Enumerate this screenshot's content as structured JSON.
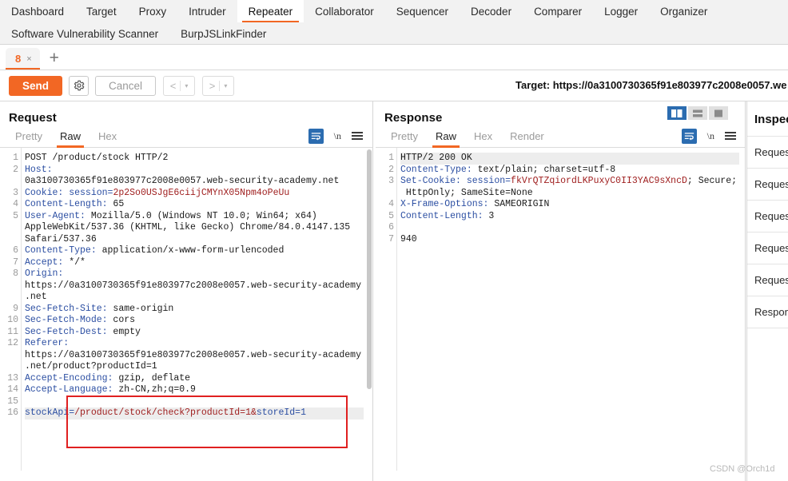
{
  "nav": {
    "row1": [
      {
        "label": "Dashboard",
        "active": false
      },
      {
        "label": "Target",
        "active": false
      },
      {
        "label": "Proxy",
        "active": false
      },
      {
        "label": "Intruder",
        "active": false
      },
      {
        "label": "Repeater",
        "active": true
      },
      {
        "label": "Collaborator",
        "active": false
      },
      {
        "label": "Sequencer",
        "active": false
      },
      {
        "label": "Decoder",
        "active": false
      },
      {
        "label": "Comparer",
        "active": false
      },
      {
        "label": "Logger",
        "active": false
      },
      {
        "label": "Organizer",
        "active": false
      }
    ],
    "row2": [
      {
        "label": "Software Vulnerability Scanner",
        "active": false
      },
      {
        "label": "BurpJSLinkFinder",
        "active": false
      }
    ]
  },
  "tabstrip": {
    "tabs": [
      {
        "label": "8",
        "close": "×"
      }
    ],
    "add_label": "+"
  },
  "toolbar": {
    "send_label": "Send",
    "settings_icon": "gear-icon",
    "cancel_label": "Cancel",
    "prev_label": "<",
    "next_label": ">",
    "caret": "▾",
    "target_label": "Target: https://0a3100730365f91e803977c2008e0057.we"
  },
  "request": {
    "title": "Request",
    "tabs": [
      {
        "label": "Pretty",
        "active": false
      },
      {
        "label": "Raw",
        "active": true
      },
      {
        "label": "Hex",
        "active": false
      }
    ],
    "icons": {
      "wrap": "word-wrap-icon",
      "newline": "\\n",
      "menu": "hamburger-menu-icon"
    },
    "lines": [
      {
        "n": "1",
        "segments": [
          {
            "t": "POST /product/stock HTTP/2",
            "c": "v"
          }
        ]
      },
      {
        "n": "2",
        "segments": [
          {
            "t": "Host:",
            "c": "k"
          }
        ]
      },
      {
        "n": "",
        "segments": [
          {
            "t": "0a3100730365f91e803977c2008e0057.web-security-academy.net",
            "c": "v"
          }
        ]
      },
      {
        "n": "3",
        "segments": [
          {
            "t": "Cookie: ",
            "c": "k"
          },
          {
            "t": "session=",
            "c": "b"
          },
          {
            "t": "2p2So0USJgE6ciijCMYnX05Npm4oPeUu",
            "c": "r"
          }
        ]
      },
      {
        "n": "4",
        "segments": [
          {
            "t": "Content-Length: ",
            "c": "k"
          },
          {
            "t": "65",
            "c": "v"
          }
        ]
      },
      {
        "n": "5",
        "segments": [
          {
            "t": "User-Agent: ",
            "c": "k"
          },
          {
            "t": "Mozilla/5.0 (Windows NT 10.0; Win64; x64)",
            "c": "v"
          }
        ]
      },
      {
        "n": "",
        "segments": [
          {
            "t": "AppleWebKit/537.36 (KHTML, like Gecko) Chrome/84.0.4147.135",
            "c": "v"
          }
        ]
      },
      {
        "n": "",
        "segments": [
          {
            "t": "Safari/537.36",
            "c": "v"
          }
        ]
      },
      {
        "n": "6",
        "segments": [
          {
            "t": "Content-Type: ",
            "c": "k"
          },
          {
            "t": "application/x-www-form-urlencoded",
            "c": "v"
          }
        ]
      },
      {
        "n": "7",
        "segments": [
          {
            "t": "Accept: ",
            "c": "k"
          },
          {
            "t": "*/*",
            "c": "v"
          }
        ]
      },
      {
        "n": "8",
        "segments": [
          {
            "t": "Origin:",
            "c": "k"
          }
        ]
      },
      {
        "n": "",
        "segments": [
          {
            "t": "https://0a3100730365f91e803977c2008e0057.web-security-academy",
            "c": "v"
          }
        ]
      },
      {
        "n": "",
        "segments": [
          {
            "t": ".net",
            "c": "v"
          }
        ]
      },
      {
        "n": "9",
        "segments": [
          {
            "t": "Sec-Fetch-Site: ",
            "c": "k"
          },
          {
            "t": "same-origin",
            "c": "v"
          }
        ]
      },
      {
        "n": "10",
        "segments": [
          {
            "t": "Sec-Fetch-Mode: ",
            "c": "k"
          },
          {
            "t": "cors",
            "c": "v"
          }
        ]
      },
      {
        "n": "11",
        "segments": [
          {
            "t": "Sec-Fetch-Dest: ",
            "c": "k"
          },
          {
            "t": "empty",
            "c": "v"
          }
        ]
      },
      {
        "n": "12",
        "segments": [
          {
            "t": "Referer:",
            "c": "k"
          }
        ]
      },
      {
        "n": "",
        "segments": [
          {
            "t": "https://0a3100730365f91e803977c2008e0057.web-security-academy",
            "c": "v"
          }
        ]
      },
      {
        "n": "",
        "segments": [
          {
            "t": ".net/product?productId=1",
            "c": "v"
          }
        ]
      },
      {
        "n": "13",
        "segments": [
          {
            "t": "Accept-Encoding: ",
            "c": "k"
          },
          {
            "t": "gzip, deflate",
            "c": "v"
          }
        ]
      },
      {
        "n": "14",
        "segments": [
          {
            "t": "Accept-Language: ",
            "c": "k"
          },
          {
            "t": "zh-CN,zh;q=0.9",
            "c": "v"
          }
        ]
      },
      {
        "n": "15",
        "segments": []
      },
      {
        "n": "16",
        "segments": [
          {
            "t": "stockApi=",
            "c": "b"
          },
          {
            "t": "/product/stock/check",
            "c": "r"
          },
          {
            "t": "?productId=1&",
            "c": "r"
          },
          {
            "t": "storeId=1",
            "c": "b"
          }
        ],
        "highlight": true
      }
    ]
  },
  "response": {
    "title": "Response",
    "tabs": [
      {
        "label": "Pretty",
        "active": false
      },
      {
        "label": "Raw",
        "active": true
      },
      {
        "label": "Hex",
        "active": false
      },
      {
        "label": "Render",
        "active": false
      }
    ],
    "icons": {
      "wrap": "word-wrap-icon",
      "newline": "\\n",
      "menu": "hamburger-menu-icon"
    },
    "layout_toggle": [
      {
        "name": "side-by-side-layout-icon",
        "active": true
      },
      {
        "name": "stacked-layout-icon",
        "active": false
      },
      {
        "name": "single-pane-layout-icon",
        "active": false
      }
    ],
    "lines": [
      {
        "n": "1",
        "segments": [
          {
            "t": "HTTP/2 200 OK",
            "c": "v"
          }
        ],
        "highlight": true
      },
      {
        "n": "2",
        "segments": [
          {
            "t": "Content-Type: ",
            "c": "k"
          },
          {
            "t": "text/plain; charset=utf-8",
            "c": "v"
          }
        ]
      },
      {
        "n": "3",
        "segments": [
          {
            "t": "Set-Cookie: ",
            "c": "k"
          },
          {
            "t": "session=",
            "c": "b"
          },
          {
            "t": "fkVrQTZqiordLKPuxyC0II3YAC9sXncD",
            "c": "r"
          },
          {
            "t": "; Secure;",
            "c": "v"
          }
        ]
      },
      {
        "n": "",
        "segments": [
          {
            "t": " HttpOnly; SameSite=None",
            "c": "v"
          }
        ]
      },
      {
        "n": "4",
        "segments": [
          {
            "t": "X-Frame-Options: ",
            "c": "k"
          },
          {
            "t": "SAMEORIGIN",
            "c": "v"
          }
        ]
      },
      {
        "n": "5",
        "segments": [
          {
            "t": "Content-Length: ",
            "c": "k"
          },
          {
            "t": "3",
            "c": "v"
          }
        ]
      },
      {
        "n": "6",
        "segments": []
      },
      {
        "n": "7",
        "segments": [
          {
            "t": "940",
            "c": "v"
          }
        ]
      }
    ]
  },
  "inspector": {
    "title": "Inspector",
    "rows": [
      {
        "label": "Request"
      },
      {
        "label": "Request"
      },
      {
        "label": "Request"
      },
      {
        "label": "Request"
      },
      {
        "label": "Request"
      },
      {
        "label": "Response"
      }
    ]
  },
  "watermark": "CSDN @Orch1d",
  "colors": {
    "accent": "#f26724",
    "header_key": "#2b4ea2",
    "value_red": "#a02020",
    "toggle_active": "#2b6cb0",
    "annotation": "#e02020"
  }
}
